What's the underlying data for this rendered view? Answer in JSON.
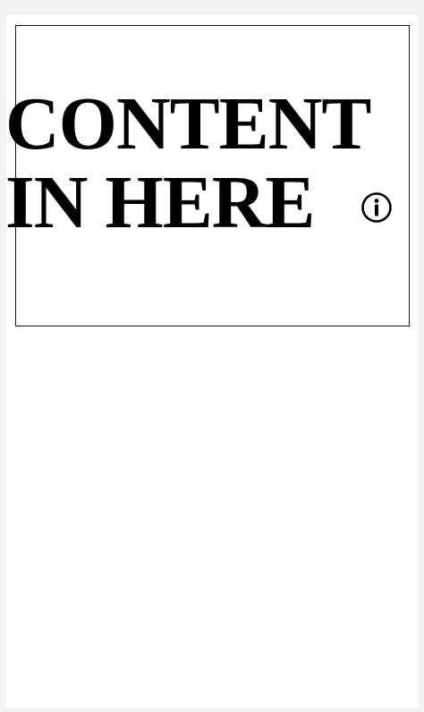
{
  "content_block": {
    "headline_line1": "CONTENT",
    "headline_line2": "IN HERE",
    "info_icon": "info-circle-icon"
  },
  "colors": {
    "background": "#f2f2f4",
    "surface": "#ffffff",
    "text": "#000000",
    "border": "#111111"
  }
}
